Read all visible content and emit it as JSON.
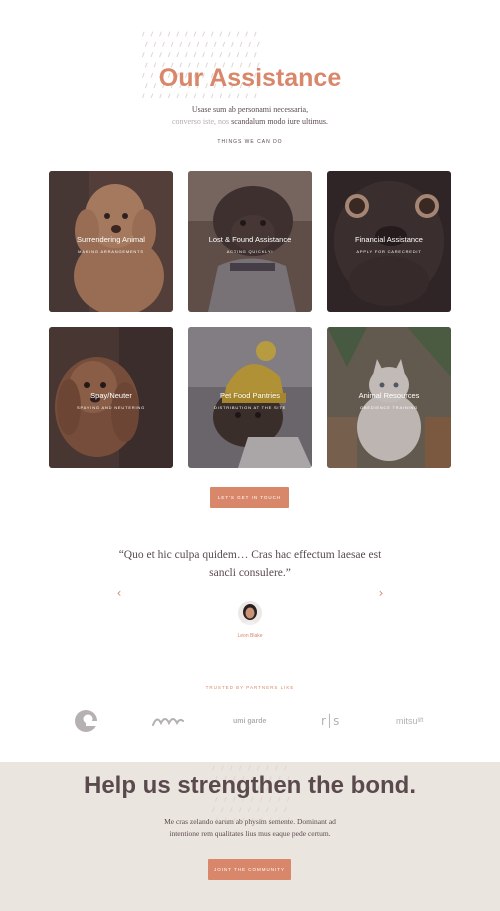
{
  "colors": {
    "accent": "#d9876a",
    "text": "#5a4a4e",
    "band": "#ebe5df"
  },
  "hero": {
    "title": "Our Assistance",
    "sub_line1": "Usase sum ab personami necessaria,",
    "sub_line2_muted": "converso iste, nos",
    "sub_line2_rest": " scandalum modo iure ultimus.",
    "eyebrow": "THINGS WE CAN DO"
  },
  "cards": [
    {
      "title": "Surrendering Animal",
      "sub": "MAKING ARRANGEMENTS",
      "image": "poodle-photo"
    },
    {
      "title": "Lost & Found Assistance",
      "sub": "ACTING QUICKLY!",
      "image": "curly-dog-photo"
    },
    {
      "title": "Financial Assistance",
      "sub": "APPLY FOR CARECREDIT",
      "image": "pug-photo"
    },
    {
      "title": "Spay/Neuter",
      "sub": "SPAYING AND NEUTERING",
      "image": "cavapoo-photo"
    },
    {
      "title": "Pet Food Pantries",
      "sub": "DISTRIBUTION AT THE SITE",
      "image": "pug-beanie-photo"
    },
    {
      "title": "Animal Resources",
      "sub": "OBEDIENCE TRAINING",
      "image": "white-cat-photo"
    }
  ],
  "cta_touch": "LET'S GET IN TOUCH",
  "testimonial": {
    "quote": "“Quo et hic culpa quidem… Cras hac effectum laesae est sancli consulere.”",
    "author": "Leon Blake",
    "prev_icon": "‹",
    "next_icon": "›"
  },
  "partners": {
    "label": "TRUSTED BY PARTNERS LIKE",
    "logos": [
      {
        "name": "c-logo",
        "text": ""
      },
      {
        "name": "wave-logo",
        "text": ""
      },
      {
        "name": "umi-logo",
        "text": "umi garde"
      },
      {
        "name": "rs-logo",
        "text": "r│s"
      },
      {
        "name": "mitsu-logo",
        "text": "mitsu",
        "sup": "lift"
      }
    ]
  },
  "band": {
    "title": "Help us strengthen the bond.",
    "text_line1": "Me cras zelando earum ab physim semente. Dominant ad",
    "text_line2": "intentione rem qualitates lius mus eaque pede certum.",
    "cta": "JOINT THE COMMUNITY"
  }
}
